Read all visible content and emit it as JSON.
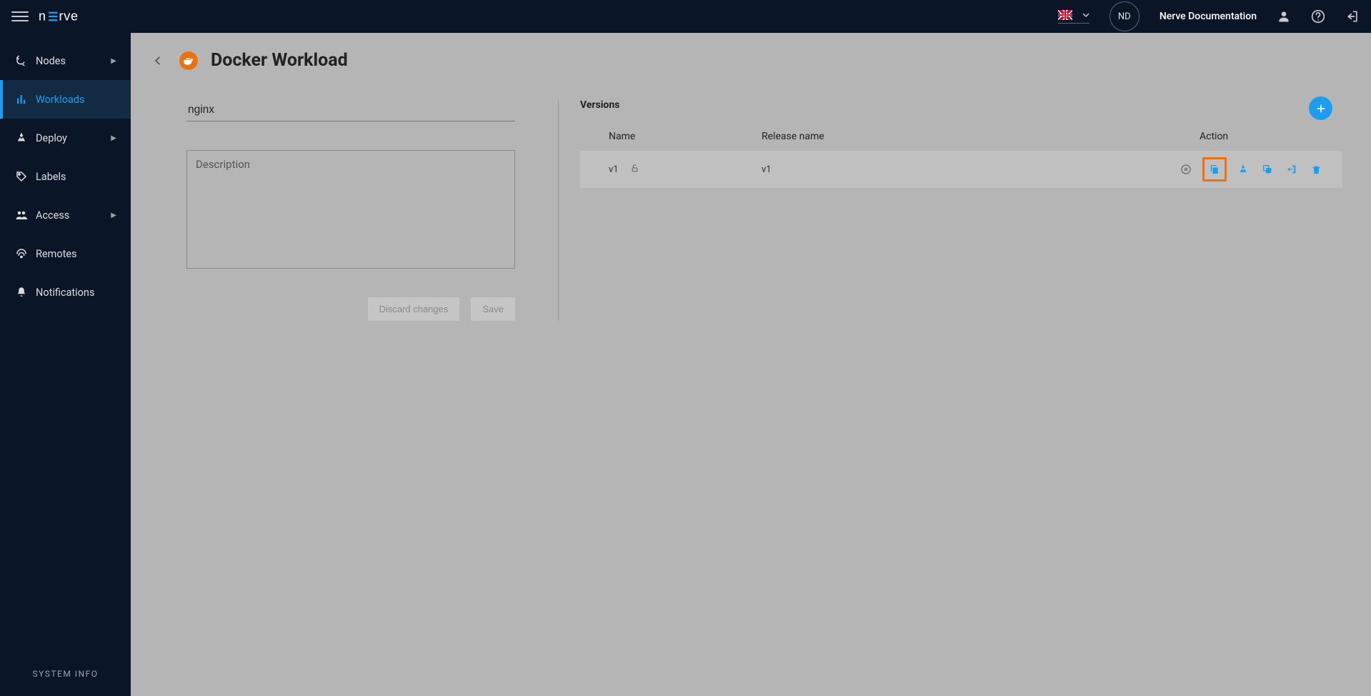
{
  "header": {
    "user_initials": "ND",
    "doc_link_label": "Nerve Documentation"
  },
  "sidebar": {
    "items": [
      {
        "label": "Nodes",
        "expandable": true
      },
      {
        "label": "Workloads",
        "expandable": false
      },
      {
        "label": "Deploy",
        "expandable": true
      },
      {
        "label": "Labels",
        "expandable": false
      },
      {
        "label": "Access",
        "expandable": true
      },
      {
        "label": "Remotes",
        "expandable": false
      },
      {
        "label": "Notifications",
        "expandable": false
      }
    ],
    "system_info_label": "SYSTEM INFO"
  },
  "page": {
    "title": "Docker Workload",
    "name_value": "nginx",
    "description_placeholder": "Description",
    "discard_label": "Discard changes",
    "save_label": "Save"
  },
  "versions": {
    "section_title": "Versions",
    "columns": {
      "name": "Name",
      "release": "Release name",
      "action": "Action"
    },
    "rows": [
      {
        "name": "v1",
        "release": "v1"
      }
    ]
  }
}
